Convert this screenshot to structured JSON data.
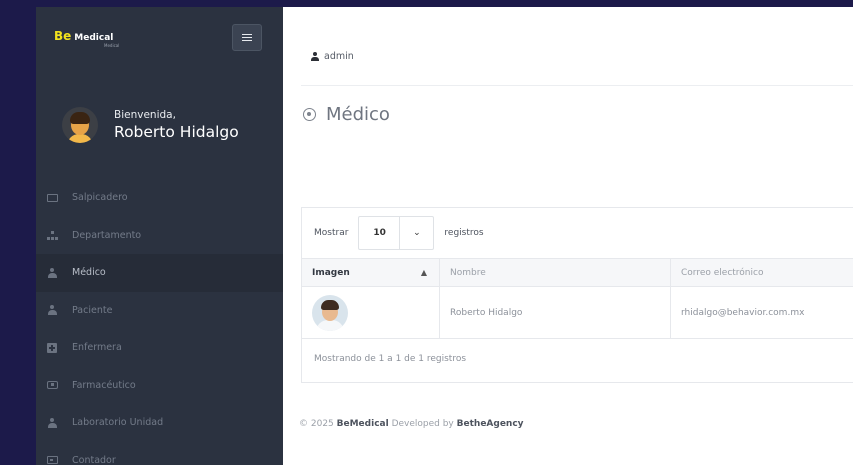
{
  "brand": {
    "primary": "Be",
    "secondary": "Medical",
    "tagline": "Medical"
  },
  "user": {
    "greeting": "Bienvenida,",
    "name": "Roberto Hidalgo"
  },
  "sidebar": {
    "items": [
      {
        "label": "Salpicadero",
        "icon": "monitor-icon"
      },
      {
        "label": "Departamento",
        "icon": "org-chart-icon"
      },
      {
        "label": "Médico",
        "icon": "person-icon",
        "active": true
      },
      {
        "label": "Paciente",
        "icon": "person-icon"
      },
      {
        "label": "Enfermera",
        "icon": "plus-square-icon"
      },
      {
        "label": "Farmacéutico",
        "icon": "pill-icon"
      },
      {
        "label": "Laboratorio Unidad",
        "icon": "person-icon"
      },
      {
        "label": "Contador",
        "icon": "card-icon"
      }
    ]
  },
  "topbar": {
    "username": "admin"
  },
  "page": {
    "title": "Médico"
  },
  "table": {
    "show_label": "Mostrar",
    "page_size": "10",
    "records_label": "registros",
    "columns": [
      "Imagen",
      "Nombre",
      "Correo electrónico"
    ],
    "rows": [
      {
        "name": "Roberto Hidalgo",
        "email": "rhidalgo@behavior.com.mx"
      }
    ],
    "info": "Mostrando de 1 a 1 de 1 registros"
  },
  "footer": {
    "prefix": "© 2025",
    "brand": "BeMedical",
    "middle": "Developed by",
    "agency": "BetheAgency"
  },
  "colors": {
    "brand_yellow": "#f2e21d",
    "sidebar_bg": "#2b3240",
    "page_bg": "#1c1a4a"
  }
}
